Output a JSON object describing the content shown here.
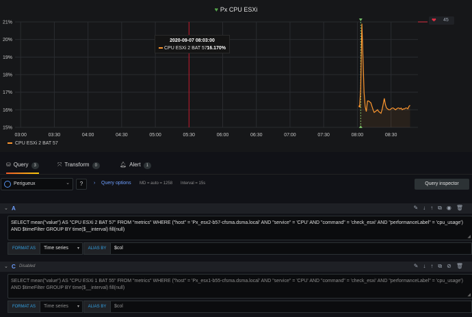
{
  "panel": {
    "title": "Px CPU ESXi",
    "alert_count": "45",
    "tooltip": {
      "time": "2020-09-07 08:03:00",
      "series": "CPU ESXi 2 BAT 57:",
      "value": "16.170%"
    },
    "legend": "CPU ESXi 2 BAT 57"
  },
  "chart_data": {
    "type": "line",
    "series": [
      {
        "name": "CPU ESXi 2 BAT 57",
        "color": "#ff9830",
        "x": [
          "08:02",
          "08:03",
          "08:04",
          "08:05",
          "08:06",
          "08:07",
          "08:08",
          "08:09",
          "08:10",
          "08:11",
          "08:12",
          "08:13",
          "08:14",
          "08:15",
          "08:16",
          "08:17",
          "08:18",
          "08:19",
          "08:20",
          "08:21",
          "08:22",
          "08:23",
          "08:24",
          "08:25",
          "08:26",
          "08:27",
          "08:28",
          "08:29",
          "08:30",
          "08:31",
          "08:32",
          "08:33",
          "08:34",
          "08:35",
          "08:36",
          "08:37",
          "08:38",
          "08:39",
          "08:40",
          "08:41",
          "08:42",
          "08:43",
          "08:44",
          "08:45",
          "08:46",
          "08:47"
        ],
        "values": [
          16.2,
          17.2,
          20.9,
          19.0,
          17.0,
          16.17,
          15.9,
          16.5,
          16.5,
          16.45,
          16.4,
          16.2,
          16.0,
          15.85,
          15.9,
          15.95,
          16.0,
          15.9,
          15.85,
          15.8,
          16.0,
          16.3,
          16.65,
          16.3,
          16.1,
          16.05,
          16.0,
          16.0,
          16.05,
          16.1,
          16.1,
          16.05,
          16.0,
          16.05,
          16.1,
          16.1,
          16.05,
          16.1,
          16.0,
          16.05,
          16.05,
          16.1,
          16.1,
          16.05,
          16.2,
          16.25
        ]
      }
    ],
    "x_ticks": [
      "03:00",
      "03:30",
      "04:00",
      "04:30",
      "05:00",
      "05:30",
      "06:00",
      "06:30",
      "07:00",
      "07:30",
      "08:00",
      "08:30"
    ],
    "y_ticks": [
      "15%",
      "16%",
      "17%",
      "18%",
      "19%",
      "20%",
      "21%"
    ],
    "ylim": [
      15,
      21
    ],
    "xlim": [
      "02:55",
      "08:54"
    ],
    "threshold": 21,
    "grid": true,
    "legend_placement": "bottom-left",
    "markers": {
      "alert_time": "05:30",
      "cursor_time": "08:03"
    }
  },
  "tabs": [
    {
      "label": "Query",
      "count": "3"
    },
    {
      "label": "Transform",
      "count": "0"
    },
    {
      "label": "Alert",
      "count": "1"
    }
  ],
  "toolbar": {
    "datasource": "Perigueux",
    "help": "?",
    "query_options": "Query options",
    "md": "MD = auto = 1258",
    "interval": "Interval = 15s",
    "inspector": "Query inspector"
  },
  "queries": [
    {
      "ref": "A",
      "disabled": "",
      "sql": "SELECT mean(\"value\") AS \"CPU ESXi 2 BAT 57\" FROM \"metrics\" WHERE (\"host\" = 'Px_esx2-b57-cfsma.dsma.local' AND \"service\" = 'CPU' AND \"command\" = 'check_esxi' AND \"performanceLabel\" = 'cpu_usage') AND $timeFilter GROUP BY time($__interval) fill(null)",
      "format_label": "FORMAT AS",
      "format_value": "Time series",
      "alias_label": "ALIAS BY",
      "alias_value": "$col"
    },
    {
      "ref": "C",
      "disabled": "Disabled",
      "sql": "SELECT mean(\"value\") AS \"CPU ESXi 1 BAT 55\" FROM \"metrics\" WHERE (\"host\" = 'Px_esx1-b55-cfsma.dsma.local' AND \"service\" = 'CPU' AND \"command\" = 'check_esxi' AND \"performanceLabel\" = 'cpu_usage') AND $timeFilter GROUP BY time($__interval) fill(null)",
      "format_label": "FORMAT AS",
      "format_value": "Time series",
      "alias_label": "ALIAS BY",
      "alias_value": "$col"
    }
  ]
}
